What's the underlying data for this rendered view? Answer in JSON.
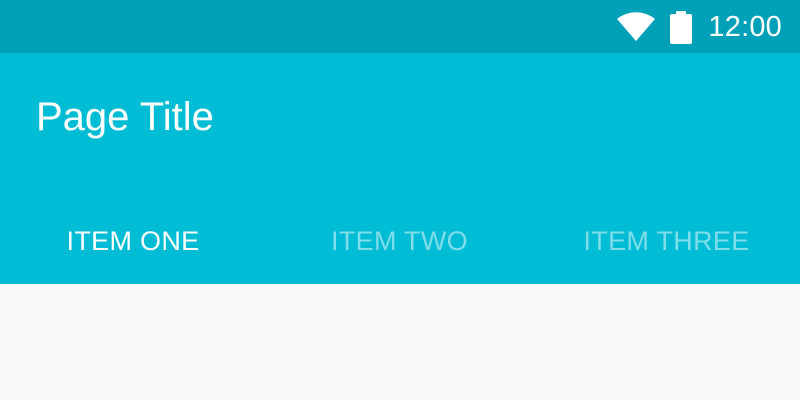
{
  "status_bar": {
    "time": "12:00",
    "wifi_icon": "wifi-icon",
    "battery_icon": "battery-icon",
    "background_color": "#00a1b8"
  },
  "app_bar": {
    "title": "Page Title",
    "background_color": "#00bcd4"
  },
  "tabs": [
    {
      "label": "ITEM ONE",
      "selected": true
    },
    {
      "label": "ITEM TWO",
      "selected": false
    },
    {
      "label": "ITEM THREE",
      "selected": false
    }
  ],
  "colors": {
    "tab_active_text": "#ffffff",
    "tab_inactive_text": "#7fdeea",
    "content_background": "#fafafa"
  }
}
